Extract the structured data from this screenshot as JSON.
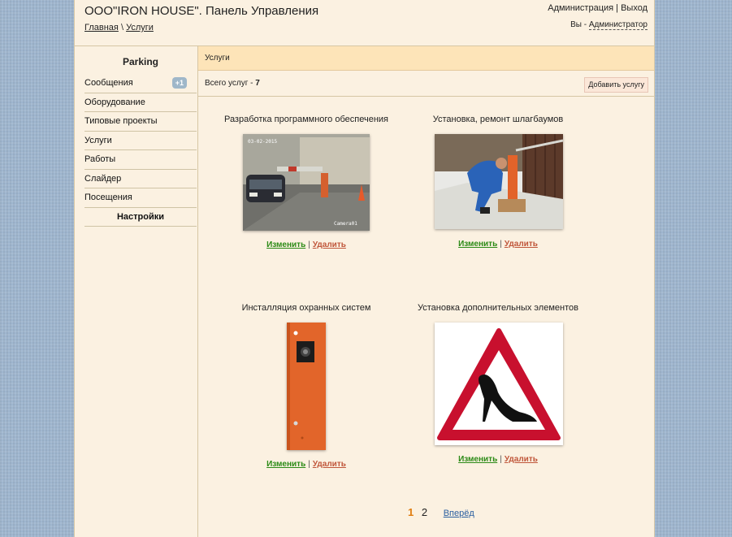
{
  "header": {
    "title": "ООО\"IRON HOUSE\". Панель Управления",
    "breadcrumb": {
      "home": "Главная",
      "separator": "\\",
      "current": "Услуги"
    },
    "links": {
      "admin": "Администрация",
      "sep": "|",
      "logout": "Выход"
    },
    "user": {
      "prefix": "Вы -",
      "name": "Администратор"
    }
  },
  "sidebar": {
    "title": "Parking",
    "items": [
      {
        "label": "Сообщения",
        "badge": "+1"
      },
      {
        "label": "Оборудование"
      },
      {
        "label": "Типовые проекты"
      },
      {
        "label": "Услуги"
      },
      {
        "label": "Работы"
      },
      {
        "label": "Слайдер"
      },
      {
        "label": "Посещения"
      },
      {
        "label": "Настройки"
      }
    ]
  },
  "main": {
    "section_title": "Услуги",
    "total_label": "Всего услуг -",
    "total_value": "7",
    "add_button": "Добавить услугу",
    "cards": [
      {
        "title": "Разработка программного обеспечения",
        "edit": "Изменить",
        "sep": "|",
        "delete": "Удалить",
        "image": "barrier-camera-photo",
        "overlay_text": "03-02-2015",
        "overlay_cam": "Camera01"
      },
      {
        "title": "Установка, ремонт шлагбаумов",
        "edit": "Изменить",
        "sep": "|",
        "delete": "Удалить",
        "image": "worker-repairing-barrier-photo"
      },
      {
        "title": "Инсталляция охранных систем",
        "edit": "Изменить",
        "sep": "|",
        "delete": "Удалить",
        "image": "orange-security-pillar-photo"
      },
      {
        "title": "Установка дополнительных элементов",
        "edit": "Изменить",
        "sep": "|",
        "delete": "Удалить",
        "image": "warning-sign-high-heel"
      }
    ],
    "pagination": {
      "current": "1",
      "next_page": "2",
      "next_label": "Вперёд"
    }
  },
  "colors": {
    "accent_orange": "#e07d10",
    "edit_green": "#2b8a16",
    "delete_red": "#c0563a",
    "header_band": "#fde4b8",
    "page_bg": "#fbf1e1"
  }
}
